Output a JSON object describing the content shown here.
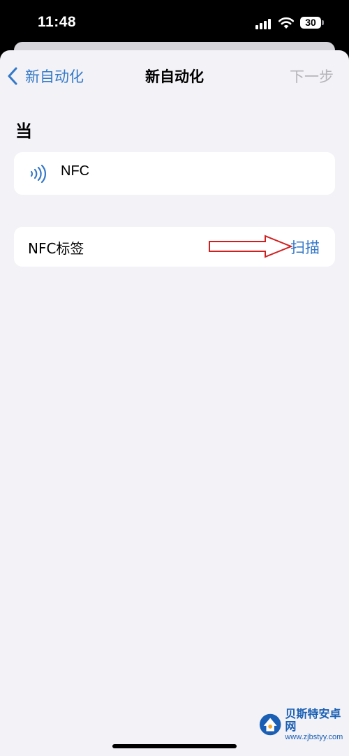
{
  "status_bar": {
    "time": "11:48",
    "battery": "30",
    "icons": [
      "signal-icon",
      "wifi-icon",
      "battery-icon"
    ]
  },
  "nav": {
    "back_label": "新自动化",
    "title": "新自动化",
    "next_label": "下一步",
    "back_icon": "chevron-left-icon"
  },
  "section": {
    "header": "当"
  },
  "trigger": {
    "icon": "nfc-icon",
    "label": "NFC"
  },
  "tag": {
    "label": "NFC标签",
    "scan_label": "扫描",
    "annotation": "red-arrow-icon"
  },
  "watermark": {
    "name": "贝斯特安卓网",
    "url": "www.zjbstyy.com"
  },
  "colors": {
    "accent": "#3478c8",
    "disabled": "#b4b4b9",
    "background": "#f2f2f7",
    "card": "#ffffff",
    "annotation": "#d11f1f"
  }
}
